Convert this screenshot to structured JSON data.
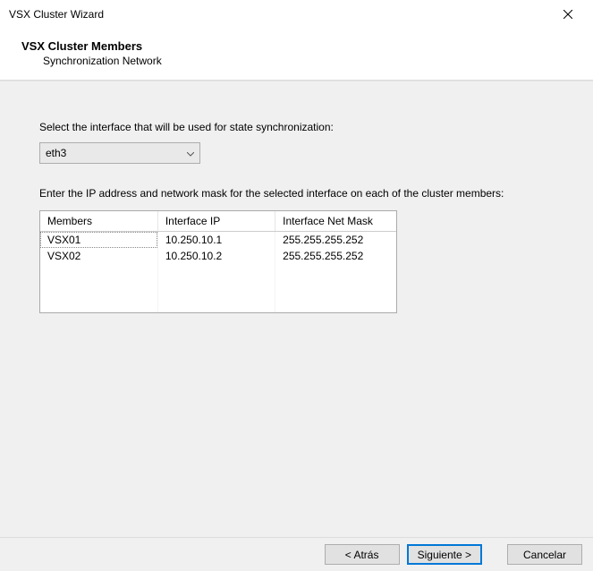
{
  "window": {
    "title": "VSX Cluster Wizard"
  },
  "header": {
    "title": "VSX Cluster Members",
    "subtitle": "Synchronization Network"
  },
  "body": {
    "instruction_select": "Select the interface that will be used for state synchronization:",
    "selected_interface": "eth3",
    "instruction_table": "Enter the IP address and network mask for the selected interface on each of the cluster members:",
    "columns": {
      "members": "Members",
      "ip": "Interface IP",
      "mask": "Interface Net Mask"
    },
    "rows": [
      {
        "member": "VSX01",
        "ip": "10.250.10.1",
        "mask": "255.255.255.252"
      },
      {
        "member": "VSX02",
        "ip": "10.250.10.2",
        "mask": "255.255.255.252"
      }
    ]
  },
  "buttons": {
    "back": "< Atrás",
    "next": "Siguiente >",
    "cancel": "Cancelar"
  }
}
